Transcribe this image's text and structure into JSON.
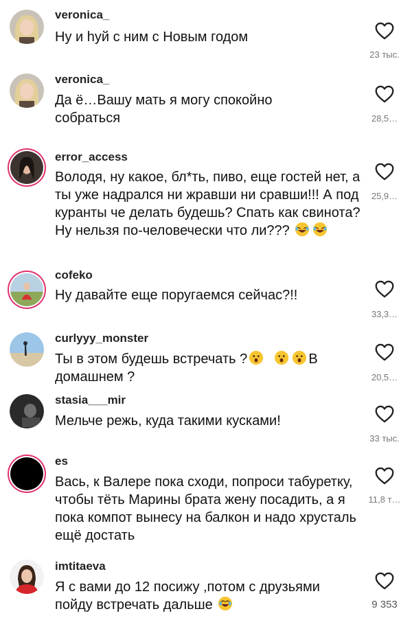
{
  "comments": [
    {
      "username": "veronica_",
      "text": "Ну и hуй с ним с Новым годом",
      "likes": "23 тыс.",
      "avatar": "photo-blonde-woman"
    },
    {
      "username": "veronica_",
      "text": "Да ё…Вашу мать я могу спокойно собраться",
      "likes": "28,5…",
      "avatar": "photo-blonde-woman"
    },
    {
      "username": "error_access",
      "text": "Володя, ну какое, бл*ть, пиво, еще гостей нет, а ты уже надрался ни жравши ни сравши!!! А под куранты че делать будешь? Спать как свинота? Ну нельзя по-человечески что ли???",
      "likes": "25,9…",
      "avatar": "photo-dark-hair"
    },
    {
      "username": "cofeko",
      "text": "Ну давайте еще поругаемся сейчас?!!",
      "likes": "33,3…",
      "avatar": "photo-field"
    },
    {
      "username": "curlyyy_monster",
      "text_a": "Ты в этом будешь встречать ?",
      "text_b": "В домашнем ?",
      "likes": "20,5…",
      "avatar": "photo-beach"
    },
    {
      "username": "stasia___mir",
      "text": "Мельче режь, куда такими кусками!",
      "likes": "33 тыс.",
      "avatar": "photo-dark"
    },
    {
      "username": "es",
      "text": "Вась, к Валере пока сходи, попроси табуретку, чтобы тёть Марины брата жену посадить, а я пока компот вынесу на балкон и надо хрусталь ещё достать",
      "likes": "11,8 т…",
      "avatar": "black-circle"
    },
    {
      "username": "imtitaeva",
      "text": "Я с вами до 12 посижу ,потом с друзьями пойду встречать дальше",
      "likes": "9 353",
      "avatar": "photo-woman-red"
    }
  ],
  "icons": {
    "like": "heart-outline-icon",
    "emoji_laugh": "rolling-on-floor-laughing-emoji",
    "emoji_surprised": "surprised-face-emoji",
    "emoji_tears": "tears-of-joy-emoji"
  },
  "colors": {
    "story_ring": "#e1306c",
    "count_gray": "#777777"
  }
}
